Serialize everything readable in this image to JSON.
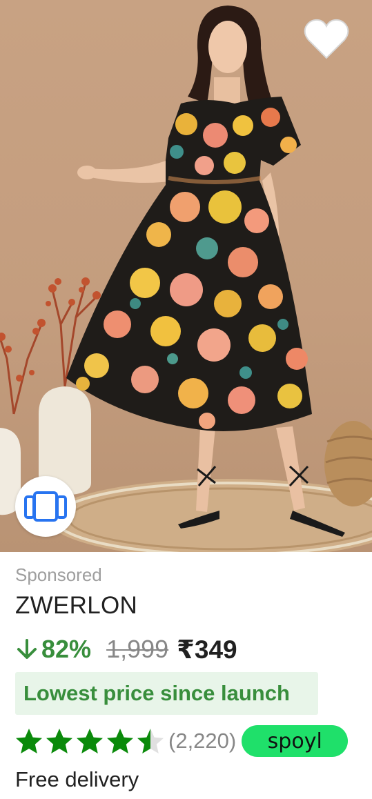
{
  "product": {
    "sponsored_label": "Sponsored",
    "brand": "ZWERLON",
    "discount": "82%",
    "mrp": "1,999",
    "price": "₹349",
    "banner": "Lowest price since launch",
    "rating_stars": 4.5,
    "rating_count": "(2,220)",
    "badge": "spoyl",
    "delivery": "Free delivery"
  },
  "icons": {
    "wishlist": "heart-icon",
    "similar": "similar-products-icon",
    "discount": "arrow-down-icon",
    "rating": "star-icon"
  },
  "colors": {
    "discount_green": "#388e3c",
    "banner_bg": "#e8f5e9",
    "star_green": "#0a8a0a",
    "badge_green": "#1fe06a",
    "muted_gray": "#878787"
  }
}
